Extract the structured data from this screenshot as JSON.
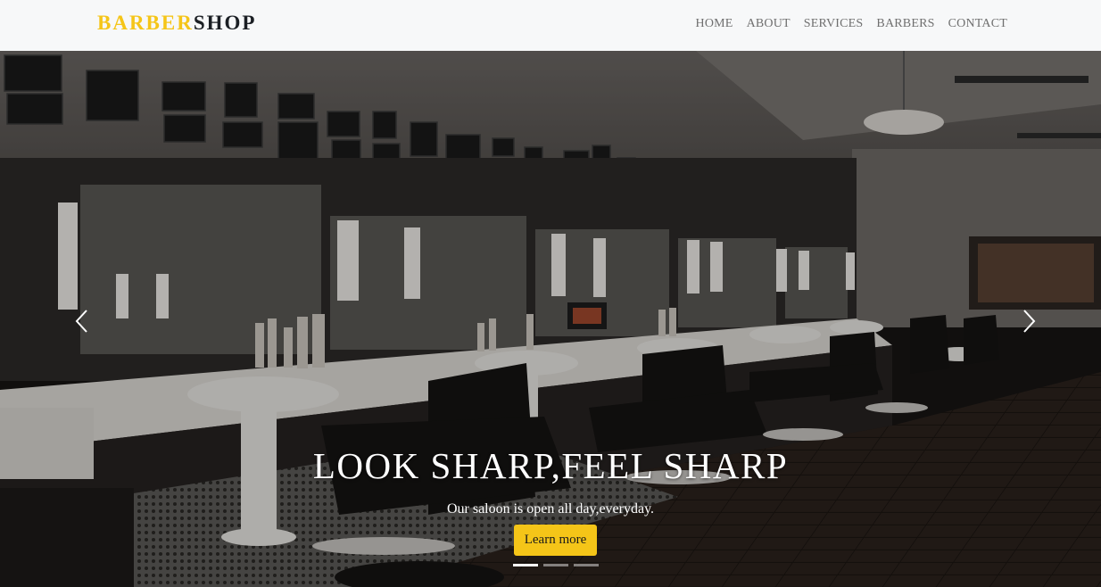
{
  "brand": {
    "part1": "BARBER",
    "part2": "SHOP",
    "accent_color": "#f5c518"
  },
  "nav": {
    "items": [
      "HOME",
      "ABOUT",
      "SERVICES",
      "BARBERS",
      "CONTACT"
    ]
  },
  "hero": {
    "title": "LOOK SHARP,FEEL SHARP",
    "subtitle": "Our saloon is open all day,everyday.",
    "button_label": "Learn more",
    "prev_icon": "chevron-left-icon",
    "next_icon": "chevron-right-icon",
    "slides_count": 3,
    "active_slide": 1
  }
}
